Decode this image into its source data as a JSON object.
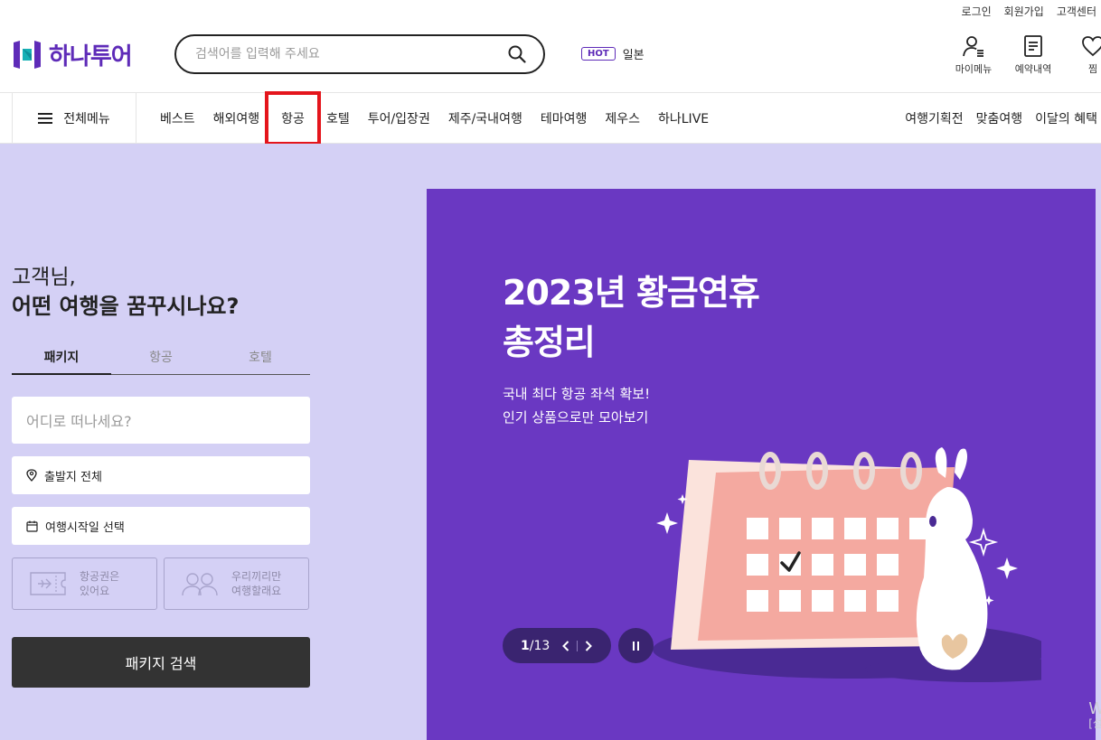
{
  "util": {
    "login": "로그인",
    "signup": "회원가입",
    "support": "고객센터"
  },
  "logo": {
    "text": "하나투어"
  },
  "search": {
    "placeholder": "검색어를 입력해 주세요"
  },
  "hot": {
    "badge": "HOT",
    "keyword": "일본"
  },
  "header_icons": [
    {
      "label": "마이메뉴",
      "icon": "user-menu-icon"
    },
    {
      "label": "예약내역",
      "icon": "document-icon"
    },
    {
      "label": "찜",
      "icon": "heart-icon"
    }
  ],
  "nav": {
    "all_menu": "전체메뉴",
    "items": [
      "베스트",
      "해외여행",
      "항공",
      "호텔",
      "투어/입장권",
      "제주/국내여행",
      "테마여행",
      "제우스",
      "하나LIVE"
    ],
    "right": [
      "여행기획전",
      "맞춤여행",
      "이달의 혜택"
    ]
  },
  "greeting": {
    "line1": "고객님,",
    "line2": "어떤 여행을 꿈꾸시나요?"
  },
  "tabs": [
    "패키지",
    "항공",
    "호텔"
  ],
  "form": {
    "destination_placeholder": "어디로 떠나세요?",
    "departure": "출발지 전체",
    "date": "여행시작일 선택",
    "option1_l1": "항공권은",
    "option1_l2": "있어요",
    "option2_l1": "우리끼리만",
    "option2_l2": "여행할래요",
    "search_button": "패키지 검색"
  },
  "banner": {
    "title_l1": "2023년 황금연휴",
    "title_l2": "총정리",
    "sub_l1": "국내 최다 항공 좌석 확보!",
    "sub_l2": "인기 상품으로만 모아보기",
    "page_current": "1",
    "page_total": "/13",
    "colors": {
      "bg": "#6a38c2",
      "calendar": "#f4a9a0",
      "pager": "#3a2470"
    }
  },
  "watermark": {
    "l1": "W",
    "l2": "[설"
  },
  "colors": {
    "brand": "#5e2bb8",
    "page_bg": "#d4d0f5",
    "highlight": "#e4151c"
  }
}
